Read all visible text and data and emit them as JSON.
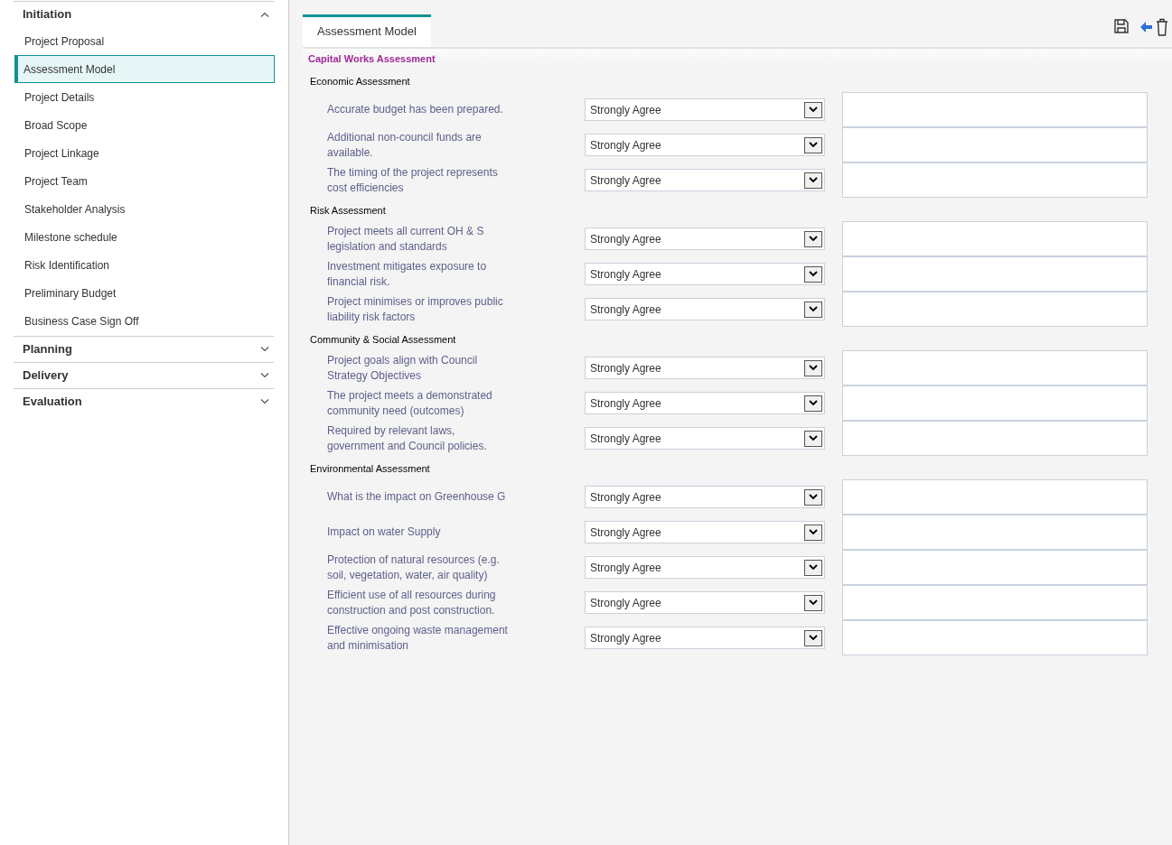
{
  "sidebar": {
    "groups": [
      {
        "label": "Initiation",
        "expanded": true,
        "items": [
          {
            "label": "Project Proposal",
            "selected": false
          },
          {
            "label": "Assessment Model",
            "selected": true
          },
          {
            "label": "Project Details",
            "selected": false
          },
          {
            "label": "Broad Scope",
            "selected": false
          },
          {
            "label": "Project Linkage",
            "selected": false
          },
          {
            "label": "Project Team",
            "selected": false
          },
          {
            "label": "Stakeholder Analysis",
            "selected": false
          },
          {
            "label": "Milestone schedule",
            "selected": false
          },
          {
            "label": "Risk Identification",
            "selected": false
          },
          {
            "label": "Preliminary Budget",
            "selected": false
          },
          {
            "label": "Business Case Sign Off",
            "selected": false
          }
        ]
      },
      {
        "label": "Planning",
        "expanded": false
      },
      {
        "label": "Delivery",
        "expanded": false
      },
      {
        "label": "Evaluation",
        "expanded": false
      }
    ]
  },
  "tabs": [
    {
      "label": "Assessment Model",
      "selected": true
    }
  ],
  "form": {
    "title": "Capital Works Assessment",
    "sections": [
      {
        "title": "Economic Assessment",
        "questions": [
          {
            "label": "Accurate budget has been prepared.",
            "answer": "Strongly Agree"
          },
          {
            "label": "Additional non-council funds are available.",
            "answer": "Strongly Agree"
          },
          {
            "label": "The timing of the project represents cost efficiencies",
            "answer": "Strongly Agree"
          }
        ]
      },
      {
        "title": "Risk Assessment",
        "questions": [
          {
            "label": "Project meets all current OH & S legislation and standards",
            "answer": "Strongly Agree"
          },
          {
            "label": "Investment mitigates exposure to financial risk.",
            "answer": "Strongly Agree"
          },
          {
            "label": "Project minimises or improves public liability risk factors",
            "answer": "Strongly Agree"
          }
        ]
      },
      {
        "title": "Community & Social Assessment",
        "questions": [
          {
            "label": "Project goals align with Council Strategy Objectives",
            "answer": "Strongly Agree"
          },
          {
            "label": "The project meets a demonstrated community need (outcomes)",
            "answer": "Strongly Agree"
          },
          {
            "label": "Required by relevant laws, government and Council policies.",
            "answer": "Strongly Agree"
          }
        ]
      },
      {
        "title": "Environmental Assessment",
        "questions": [
          {
            "label": "What is the impact on Greenhouse G",
            "answer": "Strongly Agree"
          },
          {
            "label": "Impact on water Supply",
            "answer": "Strongly Agree"
          },
          {
            "label": "Protection of natural resources (e.g. soil, vegetation, water, air quality)",
            "answer": "Strongly Agree"
          },
          {
            "label": "Efficient use of all resources during construction and post construction.",
            "answer": "Strongly Agree"
          },
          {
            "label": "Effective ongoing waste management and minimisation",
            "answer": "Strongly Agree"
          }
        ]
      }
    ]
  }
}
